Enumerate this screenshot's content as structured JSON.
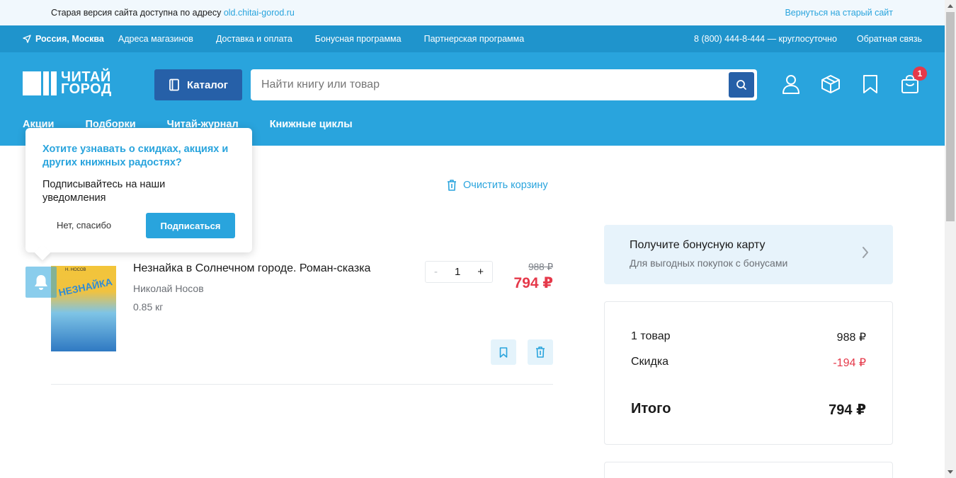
{
  "notice": {
    "text": "Старая версия сайта доступна по адресу ",
    "link": "old.chitai-gorod.ru",
    "back": "Вернуться на старый сайт"
  },
  "service": {
    "location": "Россия, Москва",
    "links": [
      "Адреса магазинов",
      "Доставка и оплата",
      "Бонусная программа",
      "Партнерская программа"
    ],
    "phone": "8 (800) 444-8-444 — круглосуточно",
    "feedback": "Обратная связь"
  },
  "header": {
    "logo_line1": "ЧИТАЙ",
    "logo_line2": "ГОРОД",
    "catalog": "Каталог",
    "search_placeholder": "Найти книгу или товар",
    "cart_count": "1",
    "subnav": [
      "Акции",
      "Подборки",
      "Читай-журнал",
      "Книжные циклы"
    ]
  },
  "cart": {
    "clear": "Очистить корзину",
    "item": {
      "cover_author": "Н. НОСОВ",
      "cover_title": "НЕЗНАЙКА",
      "title": "Незнайка в Солнечном городе. Роман-сказка",
      "author": "Николай Носов",
      "weight": "0.85 кг",
      "quantity": "1",
      "minus": "-",
      "plus": "+",
      "old_price": "988 ₽",
      "price": "794 ₽"
    }
  },
  "bonus": {
    "title": "Получите бонусную карту",
    "subtitle": "Для выгодных покупок с бонусами"
  },
  "summary": {
    "items_label": "1 товар",
    "items_value": "988 ₽",
    "discount_label": "Скидка",
    "discount_value": "-194 ₽",
    "total_label": "Итого",
    "total_value": "794 ₽"
  },
  "popup": {
    "heading": "Хотите узнавать о скидках, акциях и других книжных радостях?",
    "text": "Подписывайтесь на наши уведомления",
    "decline": "Нет, спасибо",
    "accept": "Подписаться"
  },
  "colors": {
    "brand_blue": "#29a4dd",
    "dark_blue": "#2660a8",
    "price_red": "#e5394a"
  }
}
